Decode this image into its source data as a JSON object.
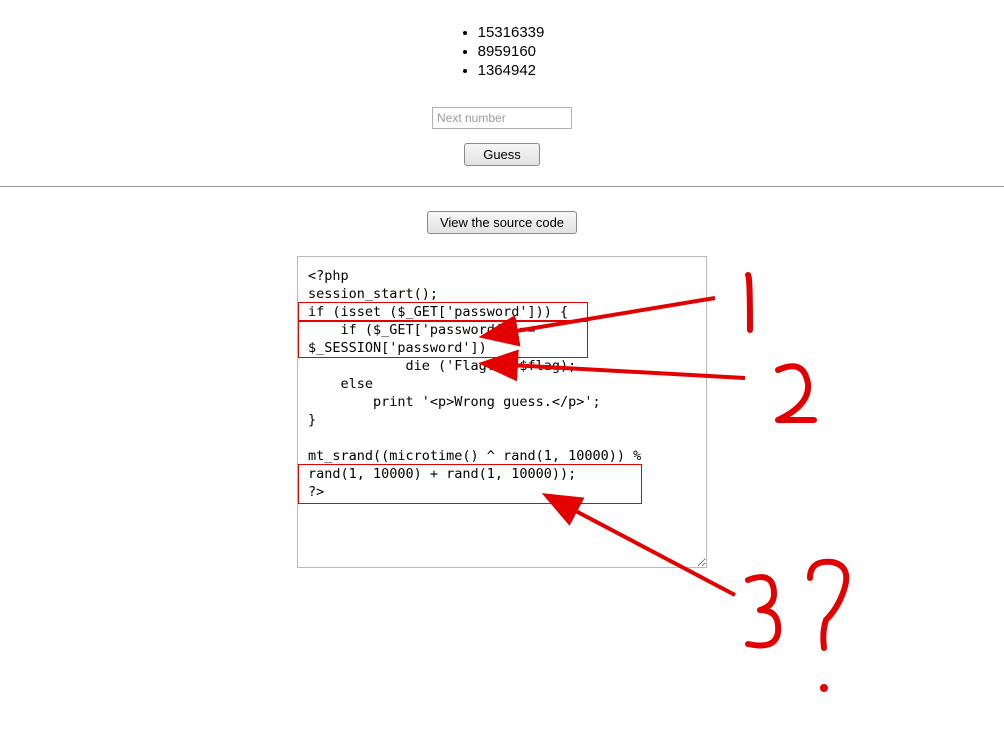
{
  "numbers": [
    "15316339",
    "8959160",
    "1364942"
  ],
  "form": {
    "placeholder": "Next number",
    "guess_label": "Guess",
    "view_source_label": "View the source code"
  },
  "source_code": "<?php\nsession_start();\nif (isset ($_GET['password'])) {\n    if ($_GET['password'] ==\n$_SESSION['password'])\n            die ('Flag: '.$flag);\n    else\n        print '<p>Wrong guess.</p>';\n}\n\nmt_srand((microtime() ^ rand(1, 10000)) %\nrand(1, 10000) + rand(1, 10000));\n?>",
  "annotations": {
    "n1": "1",
    "n2": "2",
    "n3": "3",
    "q": "?"
  }
}
